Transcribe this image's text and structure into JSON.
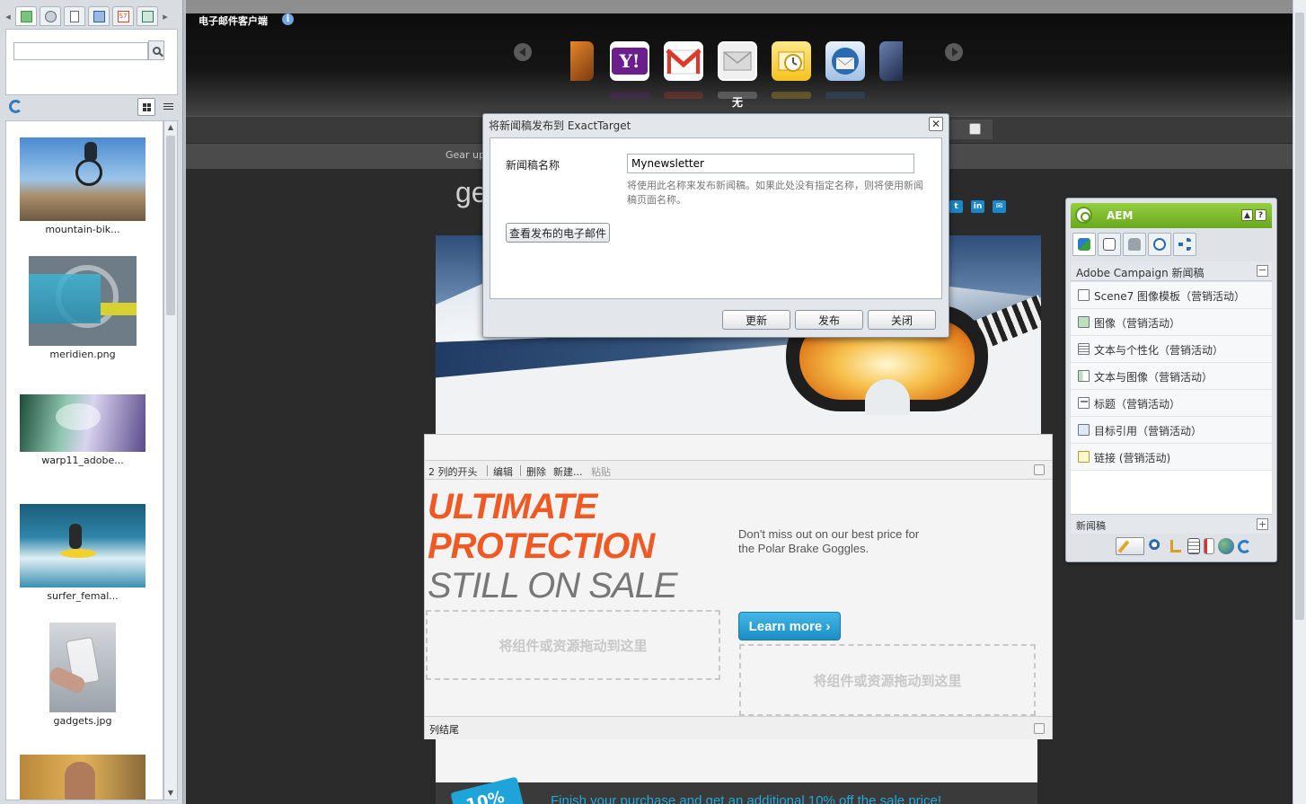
{
  "side_panel": {
    "tabs": [
      {
        "name": "image-tab-icon",
        "color": "#3a9c3a"
      },
      {
        "name": "product-tab-icon",
        "color": "#5a6a7a"
      },
      {
        "name": "document-tab-icon",
        "color": "#7a8a9a"
      },
      {
        "name": "movie-tab-icon",
        "color": "#2f5f9f"
      },
      {
        "name": "s7-tab-icon",
        "color": "#d24a2a",
        "label": "S7"
      },
      {
        "name": "page-tab-icon",
        "color": "#2f7f5f"
      }
    ],
    "search": {
      "placeholder": "",
      "value": ""
    },
    "assets": [
      {
        "name": "mountain-bik..."
      },
      {
        "name": "meridien.png"
      },
      {
        "name": "warp11_adobe..."
      },
      {
        "name": "surfer_femal..."
      },
      {
        "name": "gadgets.jpg"
      },
      {
        "name": ""
      }
    ]
  },
  "email_clients": {
    "title": "电子邮件客户端",
    "selected_label": "无",
    "clients": [
      {
        "name": "partial-left-client",
        "color": "#b0601a"
      },
      {
        "name": "yahoo-mail-icon",
        "color": "#6b1e8c",
        "label": "Y!"
      },
      {
        "name": "gmail-icon",
        "color": "#ffffff"
      },
      {
        "name": "none-envelope-icon",
        "color": "#e9e9e9"
      },
      {
        "name": "outlook-icon",
        "color": "#f4c21e"
      },
      {
        "name": "thunderbird-icon",
        "color": "#2a6ab0"
      },
      {
        "name": "partial-right-client",
        "color": "#3a4f78"
      }
    ]
  },
  "page": {
    "gear_up_text": "Gear up",
    "ge_text": "ge",
    "social": [
      "t",
      "in",
      "✉"
    ]
  },
  "paragraph": {
    "toolbar": {
      "column_start": "2 列的开头",
      "edit": "编辑",
      "delete": "删除",
      "new": "新建...",
      "paste": "粘贴"
    },
    "headline": [
      "ULTIMATE",
      "PROTECTION",
      "STILL ON SALE"
    ],
    "promo_text": "Don't miss out on our best price for the Polar Brake Goggles.",
    "learn_more": "Learn more ›",
    "dropzone_text": "将组件或资源拖动到这里",
    "column_end": "列结尾",
    "footer_promo": "Finish your purchase and get an additional 10% off the sale price!",
    "badge": "10%"
  },
  "dialog": {
    "title": "将新闻稿发布到 ExactTarget",
    "name_label": "新闻稿名称",
    "name_value": "Mynewsletter",
    "hint": "将使用此名称来发布新闻稿。如果此处没有指定名称，则将使用新闻稿页面名称。",
    "view_published": "查看发布的电子邮件",
    "buttons": {
      "update": "更新",
      "publish": "发布",
      "close": "关闭"
    }
  },
  "sidekick": {
    "title": "AEM",
    "group_title": "Adobe Campaign 新闻稿",
    "items": [
      {
        "label": "Scene7 图像模板（营销活动）"
      },
      {
        "label": "图像（营销活动）"
      },
      {
        "label": "文本与个性化（营销活动）"
      },
      {
        "label": "文本与图像（营销活动）"
      },
      {
        "label": "标题（营销活动）"
      },
      {
        "label": "目标引用（营销活动）"
      },
      {
        "label": "链接 (营销活动)"
      }
    ],
    "newsletter_label": "新闻稿"
  }
}
